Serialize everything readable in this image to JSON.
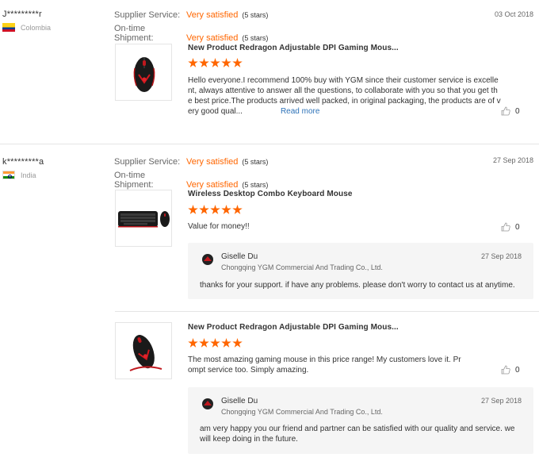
{
  "labels": {
    "supplier_service": "Supplier Service:",
    "ontime_shipment": "On-time Shipment:",
    "read_more": "Read more"
  },
  "reviews": [
    {
      "buyer": "J*********r",
      "country": "Colombia",
      "flag_icon": "colombia-flag-icon",
      "supplier_service": "Very satisfied",
      "supplier_stars": "(5 stars)",
      "shipment": "Very satisfied",
      "shipment_stars": "(5 stars)",
      "date": "03 Oct 2018",
      "products": [
        {
          "title": "New Product Redragon Adjustable DPI Gaming Mous...",
          "rating": 5,
          "text": "Hello everyone.I recommend 100% buy with YGM since their customer service is excellent, always attentive to answer all the questions, to collaborate with you so that you get the best price.The products arrived well packed, in original packaging, the products are of very good qual...",
          "helpful": "0",
          "image_icon": "gaming-mouse-image"
        }
      ]
    },
    {
      "buyer": "k*********a",
      "country": "India",
      "flag_icon": "india-flag-icon",
      "supplier_service": "Very satisfied",
      "supplier_stars": "(5 stars)",
      "shipment": "Very satisfied",
      "shipment_stars": "(5 stars)",
      "date": "27 Sep 2018",
      "products": [
        {
          "title": "Wireless Desktop Combo Keyboard Mouse",
          "rating": 5,
          "text": "Value for money!!",
          "helpful": "0",
          "image_icon": "keyboard-mouse-image",
          "reply": {
            "name": "Giselle Du",
            "company": "Chongqing YGM Commercial And Trading Co., Ltd.",
            "date": "27 Sep 2018",
            "text": "thanks for your support. if have any problems. please don't worry to contact us at anytime."
          }
        },
        {
          "title": "New Product Redragon Adjustable DPI Gaming Mous...",
          "rating": 5,
          "text": "The most amazing gaming mouse in this price range! My customers love it. Prompt service too. Simply amazing.",
          "helpful": "0",
          "image_icon": "gaming-mouse-image",
          "reply": {
            "name": "Giselle Du",
            "company": "Chongqing YGM Commercial And Trading Co., Ltd.",
            "date": "27 Sep 2018",
            "text": "am very happy you our friend and partner can be satisfied with our quality and service. we will keep doing in the future."
          }
        }
      ]
    }
  ],
  "colors": {
    "accent": "#ff6600",
    "link": "#2e73b8",
    "reply_bg": "#f5f5f5"
  }
}
